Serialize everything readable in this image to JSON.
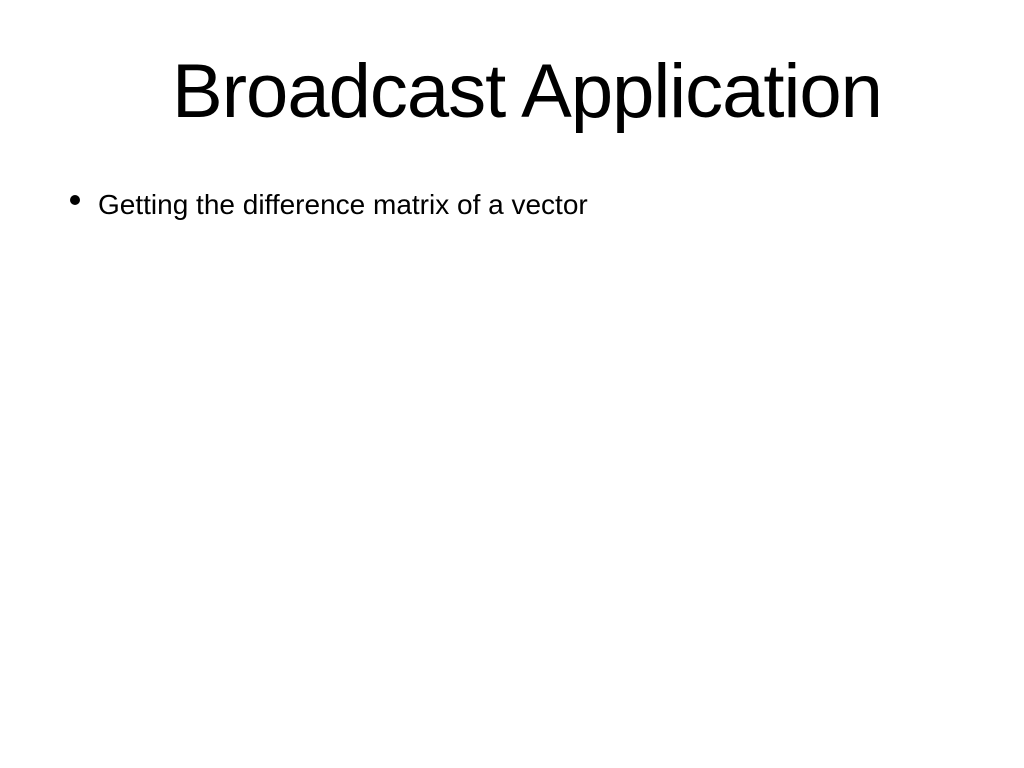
{
  "slide": {
    "title": "Broadcast Application",
    "bullets": [
      {
        "text": "Getting the difference matrix of a vector"
      }
    ]
  }
}
